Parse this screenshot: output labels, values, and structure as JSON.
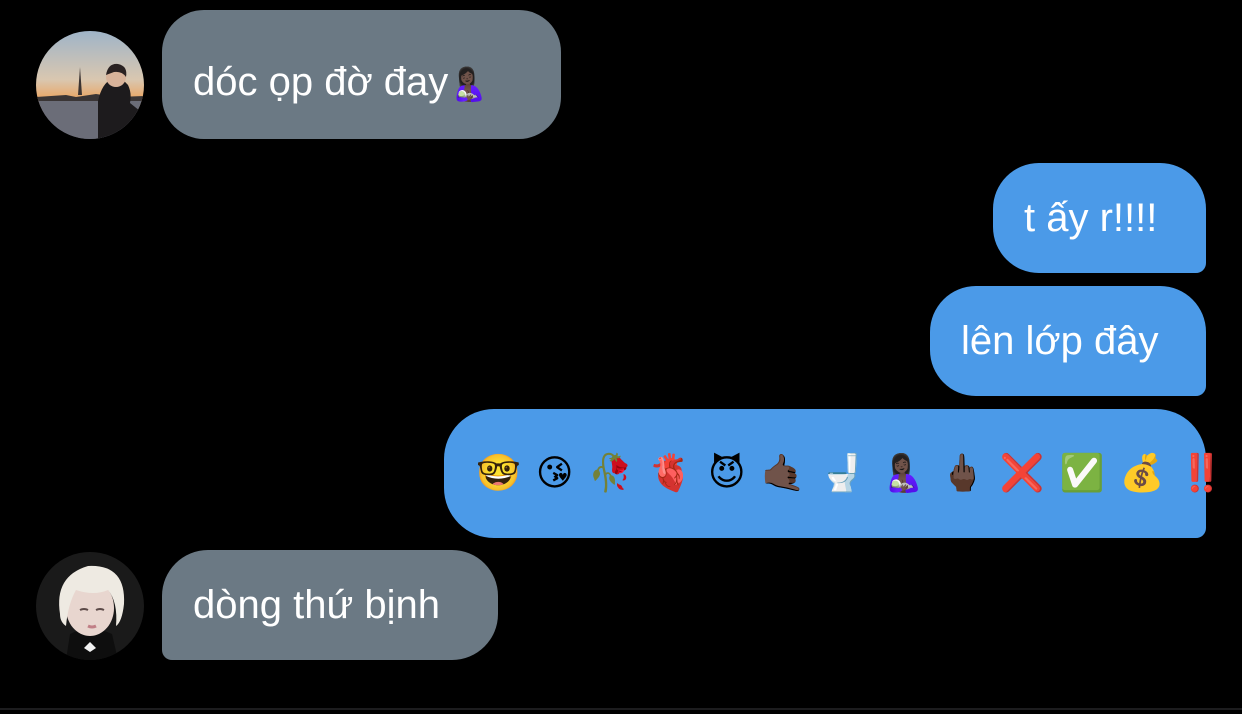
{
  "colors": {
    "background": "#000000",
    "incoming_bubble": "#6b7984",
    "outgoing_bubble": "#4b9ae8",
    "text": "#ffffff"
  },
  "messages": [
    {
      "direction": "incoming",
      "text": "dóc ọp đờ đay",
      "trailing_emoji": "🤱🏿"
    },
    {
      "direction": "outgoing",
      "text": "t ấy r!!!!"
    },
    {
      "direction": "outgoing",
      "text": "lên lớp đây"
    },
    {
      "direction": "outgoing",
      "emojis": [
        "🤓",
        "😘",
        "🥀",
        "🫀",
        "😈",
        "🤙🏿",
        "🚽",
        "🤱🏿",
        "🖕🏿",
        "❌",
        "✅",
        "💰",
        "‼️"
      ]
    },
    {
      "direction": "incoming",
      "text": "dòng thứ bịnh"
    }
  ],
  "avatars": {
    "first": "avatar-icon",
    "second": "avatar-icon"
  }
}
